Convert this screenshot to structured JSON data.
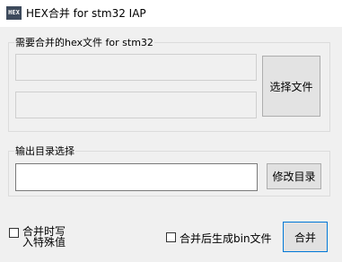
{
  "window": {
    "title": "HEX合并 for stm32 IAP",
    "icon": "HEX"
  },
  "hex_group": {
    "legend": "需要合并的hex文件 for stm32",
    "select_button": "选择文件"
  },
  "output_group": {
    "legend": "输出目录选择",
    "modify_button": "修改目录",
    "path_value": ""
  },
  "options": {
    "write_special_line1": "合并时写",
    "write_special_line2": "入特殊值",
    "generate_bin": "合并后生成bin文件"
  },
  "merge_button": "合并"
}
